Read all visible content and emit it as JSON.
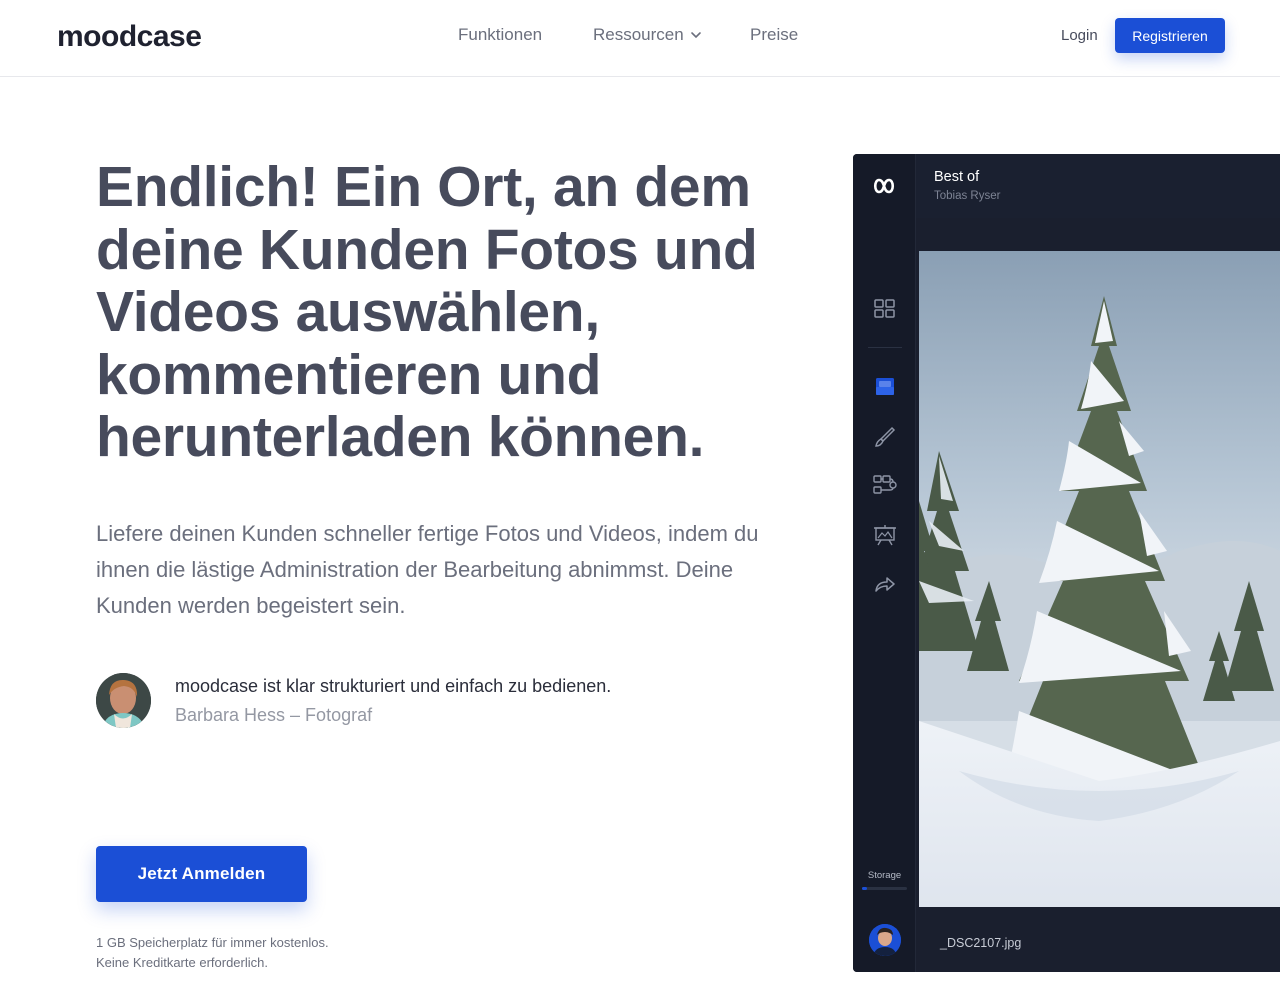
{
  "header": {
    "logo": "moodcase",
    "nav": {
      "funktionen": "Funktionen",
      "ressourcen": "Ressourcen",
      "preise": "Preise"
    },
    "login": "Login",
    "register": "Registrieren"
  },
  "hero": {
    "headline": "Endlich! Ein Ort, an dem deine Kunden Fotos und Videos auswählen, kommentieren und herunterladen können.",
    "subheadline": "Liefere deinen Kunden schneller fertige Fotos und Videos, indem du ihnen die lästige Administration der Bearbeitung abnimmst. Deine Kunden werden begeistert sein.",
    "testimonial": {
      "quote": "moodcase ist klar strukturiert und einfach zu bedienen.",
      "author": "Barbara Hess – Fotograf"
    },
    "cta": "Jetzt Anmelden",
    "note_line1": "1 GB Speicherplatz für immer kostenlos.",
    "note_line2": "Keine Kreditkarte erforderlich."
  },
  "app_preview": {
    "album_title": "Best of",
    "album_owner": "Tobias Ryser",
    "storage_label": "Storage",
    "storage_fraction": 0.1,
    "filename": "_DSC2107.jpg",
    "icons": [
      "infinity-logo-icon",
      "grid-icon",
      "inbox-icon",
      "brush-icon",
      "workflow-icon",
      "presentation-icon",
      "share-icon"
    ]
  },
  "colors": {
    "accent": "#1b4fd6",
    "text": "#474b5c",
    "app_bg": "#1a1f2e"
  }
}
